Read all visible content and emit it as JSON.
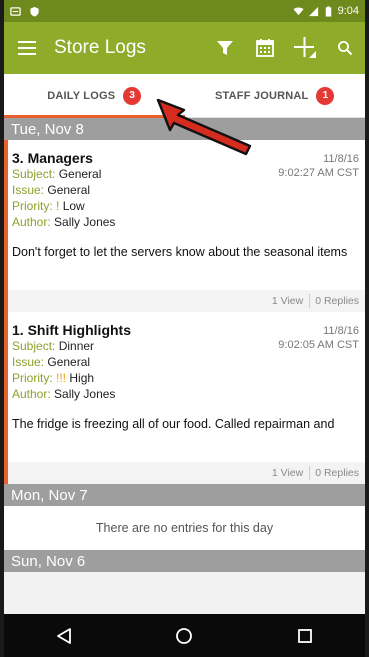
{
  "status_bar": {
    "time": "9:04",
    "colors": {
      "background": "#6f8a1c"
    }
  },
  "app_bar": {
    "title": "Store Logs",
    "background": "#8eac2a"
  },
  "tabs": [
    {
      "label": "DAILY LOGS",
      "badge": "3",
      "active": true
    },
    {
      "label": "STAFF JOURNAL",
      "badge": "1",
      "active": false
    }
  ],
  "days": [
    {
      "date": "Tue, Nov 8",
      "entries": [
        {
          "title": "3. Managers",
          "date": "11/8/16",
          "time": "9:02:27 AM CST",
          "subject_label": "Subject:",
          "subject": "General",
          "issue_label": "Issue:",
          "issue": "General",
          "priority_label": "Priority:",
          "priority_marker": "!",
          "priority": "Low",
          "author_label": "Author:",
          "author": "Sally Jones",
          "text": "Don't forget to let the servers know about the seasonal items",
          "views": "1 View",
          "replies": "0 Replies"
        },
        {
          "title": "1. Shift Highlights",
          "date": "11/8/16",
          "time": "9:02:05 AM CST",
          "subject_label": "Subject:",
          "subject": "Dinner",
          "issue_label": "Issue:",
          "issue": "General",
          "priority_label": "Priority:",
          "priority_marker": "!!!",
          "priority": "High",
          "author_label": "Author:",
          "author": "Sally Jones",
          "text": "The fridge is freezing all of our food. Called repairman and",
          "views": "1 View",
          "replies": "0 Replies"
        }
      ]
    },
    {
      "date": "Mon, Nov 7",
      "empty_message": "There are no entries for this day"
    },
    {
      "date": "Sun, Nov 6"
    }
  ],
  "colors": {
    "accent": "#e8602c",
    "badge": "#e53935",
    "meta_green": "#8aa22b",
    "priority_high": "#f2a21c"
  }
}
